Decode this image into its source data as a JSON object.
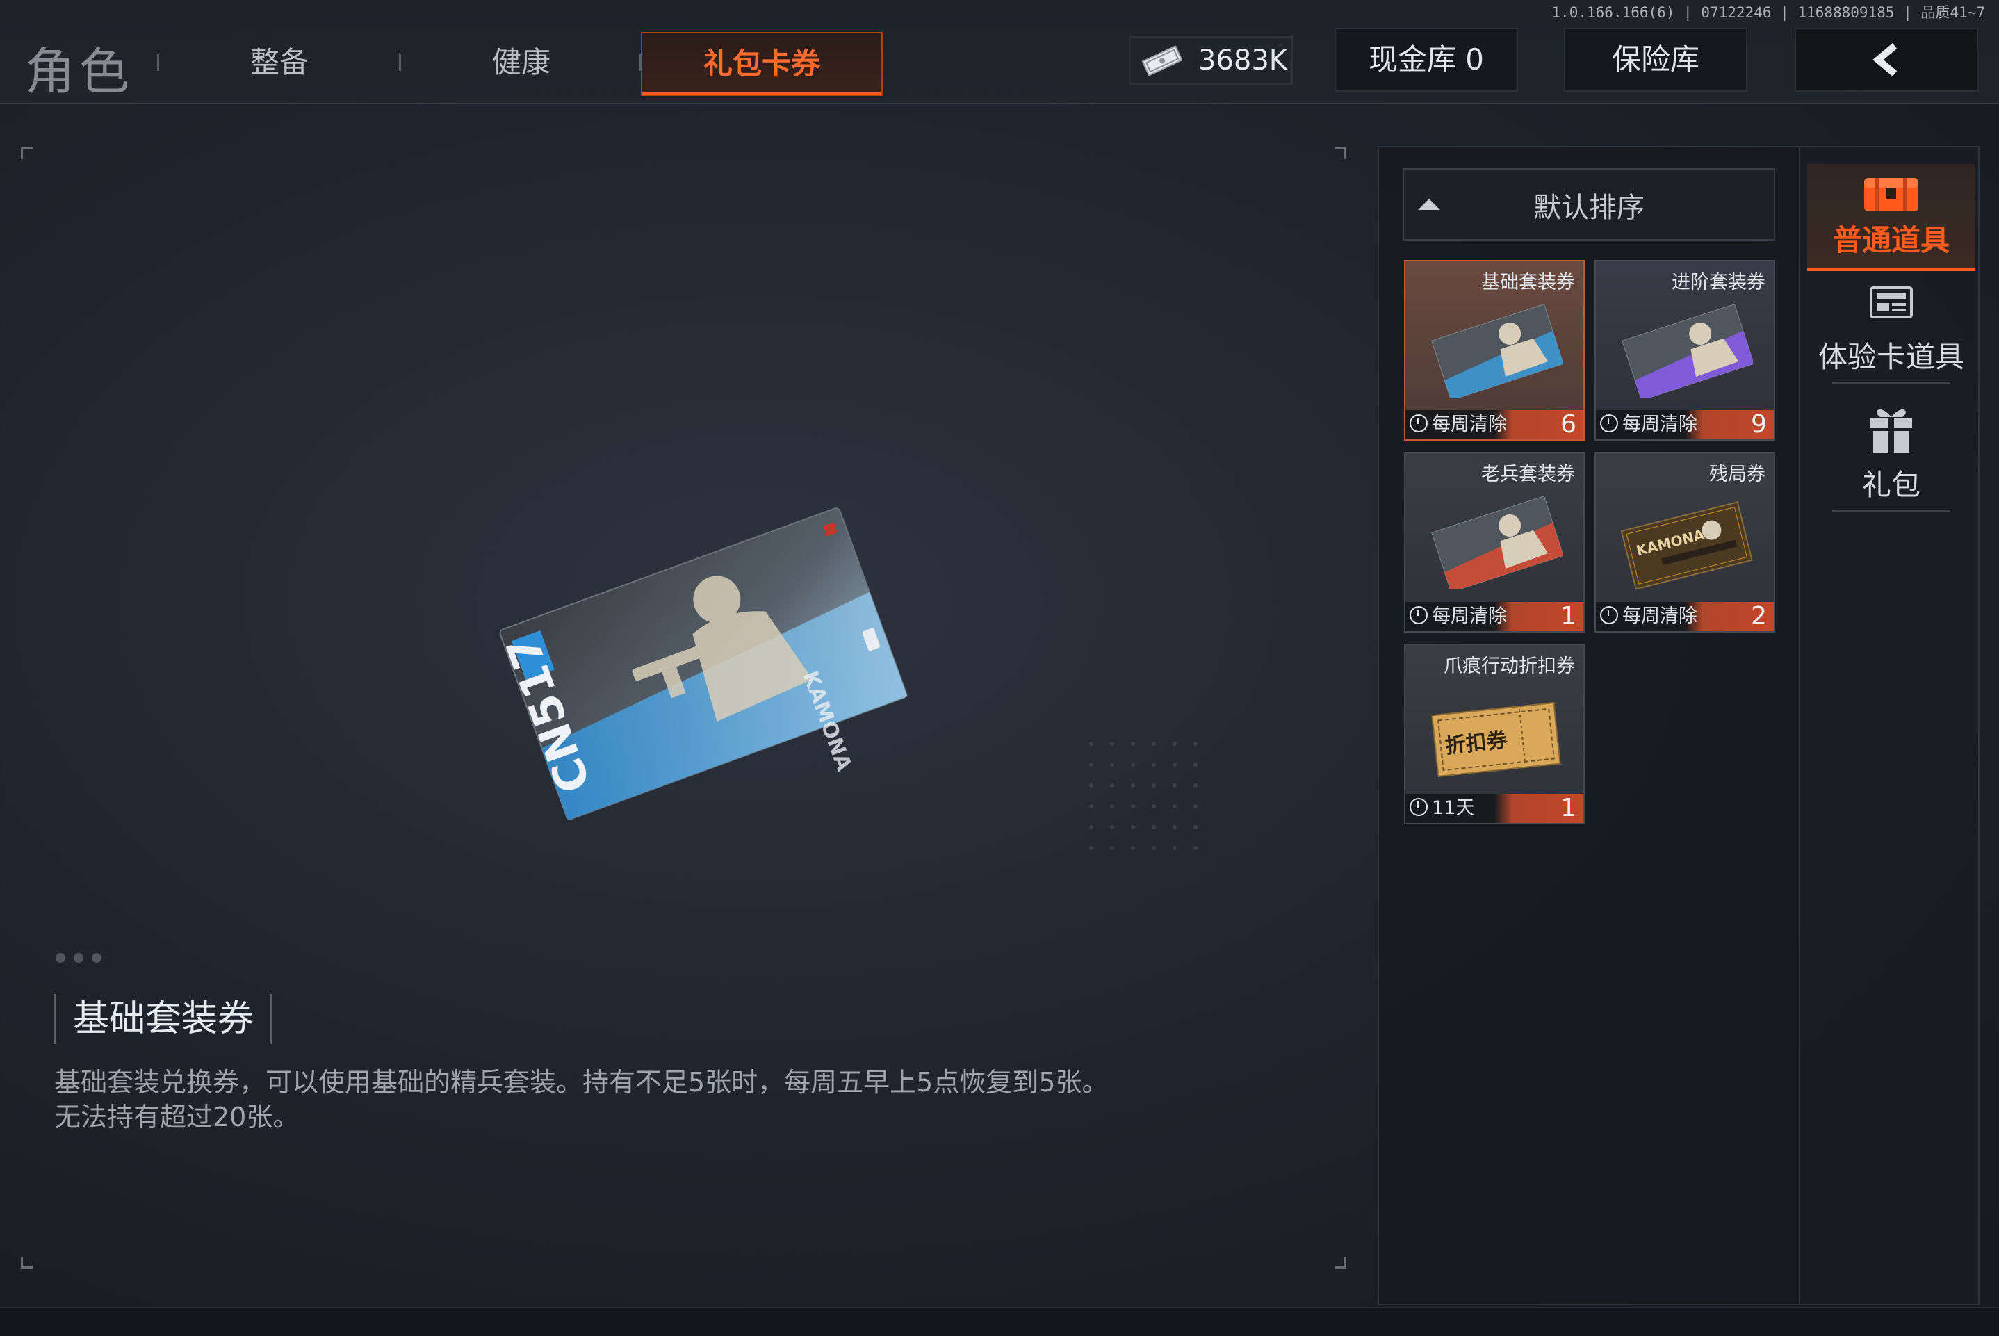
{
  "version": "1.0.166.166(6) | 07122246 | 11688809185 | 品质41~7",
  "header": {
    "page_title": "角色",
    "tabs": [
      "整备",
      "健康",
      "礼包卡券"
    ],
    "active_tab_index": 2,
    "currency_value": "3683K",
    "cash_vault_label": "现金库 0",
    "safe_box_label": "保险库"
  },
  "detail": {
    "item_name": "基础套装券",
    "description": "基础套装兑换券，可以使用基础的精兵套装。持有不足5张时，每周五早上5点恢复到5张。无法持有超过20张。",
    "card_text": "CN517",
    "card_side_text": "KAMONA"
  },
  "inventory": {
    "sort_label": "默认排序",
    "items": [
      {
        "title": "基础套装券",
        "timer": "每周清除",
        "count": "6",
        "accent": "#3a9fe0",
        "selected": true
      },
      {
        "title": "进阶套装券",
        "timer": "每周清除",
        "count": "9",
        "accent": "#8b5cf6",
        "selected": false
      },
      {
        "title": "老兵套装券",
        "timer": "每周清除",
        "count": "1",
        "accent": "#e14a30",
        "selected": false
      },
      {
        "title": "残局券",
        "timer": "每周清除",
        "count": "2",
        "accent": "#c88b2a",
        "selected": false,
        "art_text": "KAMONA"
      },
      {
        "title": "爪痕行动折扣券",
        "timer": "11天",
        "count": "1",
        "accent": "#d9a85a",
        "selected": false,
        "art_text": "折扣券"
      }
    ]
  },
  "categories": [
    {
      "label": "普通道具",
      "icon": "chest-icon",
      "active": true
    },
    {
      "label": "体验卡道具",
      "icon": "card-icon",
      "active": false
    },
    {
      "label": "礼包",
      "icon": "gift-icon",
      "active": false
    }
  ],
  "colors": {
    "accent": "#ff5b1c",
    "active_tab_text": "#ff6a2e"
  }
}
